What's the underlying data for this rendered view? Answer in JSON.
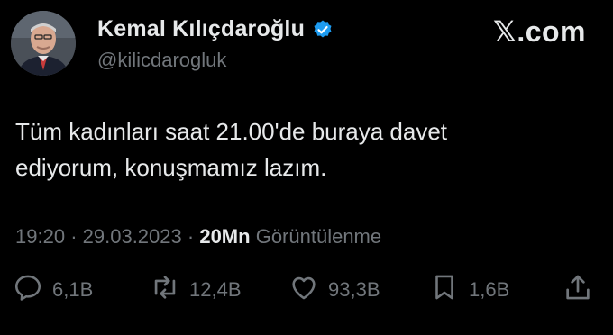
{
  "profile": {
    "name": "Kemal Kılıçdaroğlu",
    "handle": "@kilicdarogluk",
    "verified_color": "#1d9bf0"
  },
  "brand": "𝕏.com",
  "tweet": {
    "text_line1": "Tüm kadınları saat 21.00'de buraya davet",
    "text_line2": "ediyorum, konuşmamız lazım.",
    "time": "19:20",
    "date": "29.03.2023",
    "views_count": "20Mn",
    "views_label": "Görüntülenme"
  },
  "actions": {
    "reply": {
      "icon": "reply-icon",
      "count": "6,1B"
    },
    "retweet": {
      "icon": "retweet-icon",
      "count": "12,4B"
    },
    "like": {
      "icon": "heart-icon",
      "count": "93,3B"
    },
    "bookmark": {
      "icon": "bookmark-icon",
      "count": "1,6B"
    },
    "share": {
      "icon": "share-icon"
    }
  }
}
